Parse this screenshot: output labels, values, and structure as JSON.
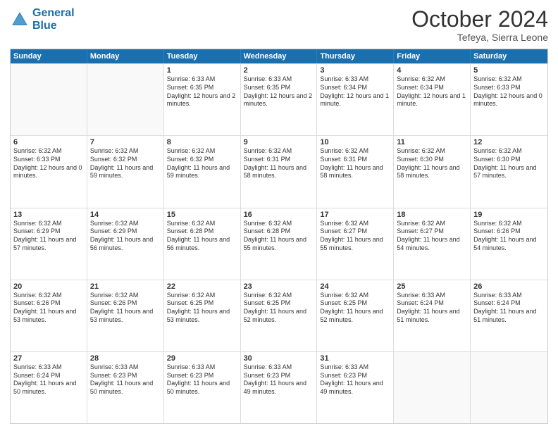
{
  "header": {
    "logo_line1": "General",
    "logo_line2": "Blue",
    "month": "October 2024",
    "location": "Tefeya, Sierra Leone"
  },
  "days": [
    "Sunday",
    "Monday",
    "Tuesday",
    "Wednesday",
    "Thursday",
    "Friday",
    "Saturday"
  ],
  "rows": [
    [
      {
        "num": "",
        "info": "",
        "empty": true
      },
      {
        "num": "",
        "info": "",
        "empty": true
      },
      {
        "num": "1",
        "info": "Sunrise: 6:33 AM\nSunset: 6:35 PM\nDaylight: 12 hours and 2 minutes.",
        "empty": false
      },
      {
        "num": "2",
        "info": "Sunrise: 6:33 AM\nSunset: 6:35 PM\nDaylight: 12 hours and 2 minutes.",
        "empty": false
      },
      {
        "num": "3",
        "info": "Sunrise: 6:33 AM\nSunset: 6:34 PM\nDaylight: 12 hours and 1 minute.",
        "empty": false
      },
      {
        "num": "4",
        "info": "Sunrise: 6:32 AM\nSunset: 6:34 PM\nDaylight: 12 hours and 1 minute.",
        "empty": false
      },
      {
        "num": "5",
        "info": "Sunrise: 6:32 AM\nSunset: 6:33 PM\nDaylight: 12 hours and 0 minutes.",
        "empty": false
      }
    ],
    [
      {
        "num": "6",
        "info": "Sunrise: 6:32 AM\nSunset: 6:33 PM\nDaylight: 12 hours and 0 minutes.",
        "empty": false
      },
      {
        "num": "7",
        "info": "Sunrise: 6:32 AM\nSunset: 6:32 PM\nDaylight: 11 hours and 59 minutes.",
        "empty": false
      },
      {
        "num": "8",
        "info": "Sunrise: 6:32 AM\nSunset: 6:32 PM\nDaylight: 11 hours and 59 minutes.",
        "empty": false
      },
      {
        "num": "9",
        "info": "Sunrise: 6:32 AM\nSunset: 6:31 PM\nDaylight: 11 hours and 58 minutes.",
        "empty": false
      },
      {
        "num": "10",
        "info": "Sunrise: 6:32 AM\nSunset: 6:31 PM\nDaylight: 11 hours and 58 minutes.",
        "empty": false
      },
      {
        "num": "11",
        "info": "Sunrise: 6:32 AM\nSunset: 6:30 PM\nDaylight: 11 hours and 58 minutes.",
        "empty": false
      },
      {
        "num": "12",
        "info": "Sunrise: 6:32 AM\nSunset: 6:30 PM\nDaylight: 11 hours and 57 minutes.",
        "empty": false
      }
    ],
    [
      {
        "num": "13",
        "info": "Sunrise: 6:32 AM\nSunset: 6:29 PM\nDaylight: 11 hours and 57 minutes.",
        "empty": false
      },
      {
        "num": "14",
        "info": "Sunrise: 6:32 AM\nSunset: 6:29 PM\nDaylight: 11 hours and 56 minutes.",
        "empty": false
      },
      {
        "num": "15",
        "info": "Sunrise: 6:32 AM\nSunset: 6:28 PM\nDaylight: 11 hours and 56 minutes.",
        "empty": false
      },
      {
        "num": "16",
        "info": "Sunrise: 6:32 AM\nSunset: 6:28 PM\nDaylight: 11 hours and 55 minutes.",
        "empty": false
      },
      {
        "num": "17",
        "info": "Sunrise: 6:32 AM\nSunset: 6:27 PM\nDaylight: 11 hours and 55 minutes.",
        "empty": false
      },
      {
        "num": "18",
        "info": "Sunrise: 6:32 AM\nSunset: 6:27 PM\nDaylight: 11 hours and 54 minutes.",
        "empty": false
      },
      {
        "num": "19",
        "info": "Sunrise: 6:32 AM\nSunset: 6:26 PM\nDaylight: 11 hours and 54 minutes.",
        "empty": false
      }
    ],
    [
      {
        "num": "20",
        "info": "Sunrise: 6:32 AM\nSunset: 6:26 PM\nDaylight: 11 hours and 53 minutes.",
        "empty": false
      },
      {
        "num": "21",
        "info": "Sunrise: 6:32 AM\nSunset: 6:26 PM\nDaylight: 11 hours and 53 minutes.",
        "empty": false
      },
      {
        "num": "22",
        "info": "Sunrise: 6:32 AM\nSunset: 6:25 PM\nDaylight: 11 hours and 53 minutes.",
        "empty": false
      },
      {
        "num": "23",
        "info": "Sunrise: 6:32 AM\nSunset: 6:25 PM\nDaylight: 11 hours and 52 minutes.",
        "empty": false
      },
      {
        "num": "24",
        "info": "Sunrise: 6:32 AM\nSunset: 6:25 PM\nDaylight: 11 hours and 52 minutes.",
        "empty": false
      },
      {
        "num": "25",
        "info": "Sunrise: 6:33 AM\nSunset: 6:24 PM\nDaylight: 11 hours and 51 minutes.",
        "empty": false
      },
      {
        "num": "26",
        "info": "Sunrise: 6:33 AM\nSunset: 6:24 PM\nDaylight: 11 hours and 51 minutes.",
        "empty": false
      }
    ],
    [
      {
        "num": "27",
        "info": "Sunrise: 6:33 AM\nSunset: 6:24 PM\nDaylight: 11 hours and 50 minutes.",
        "empty": false
      },
      {
        "num": "28",
        "info": "Sunrise: 6:33 AM\nSunset: 6:23 PM\nDaylight: 11 hours and 50 minutes.",
        "empty": false
      },
      {
        "num": "29",
        "info": "Sunrise: 6:33 AM\nSunset: 6:23 PM\nDaylight: 11 hours and 50 minutes.",
        "empty": false
      },
      {
        "num": "30",
        "info": "Sunrise: 6:33 AM\nSunset: 6:23 PM\nDaylight: 11 hours and 49 minutes.",
        "empty": false
      },
      {
        "num": "31",
        "info": "Sunrise: 6:33 AM\nSunset: 6:23 PM\nDaylight: 11 hours and 49 minutes.",
        "empty": false
      },
      {
        "num": "",
        "info": "",
        "empty": true
      },
      {
        "num": "",
        "info": "",
        "empty": true
      }
    ]
  ]
}
